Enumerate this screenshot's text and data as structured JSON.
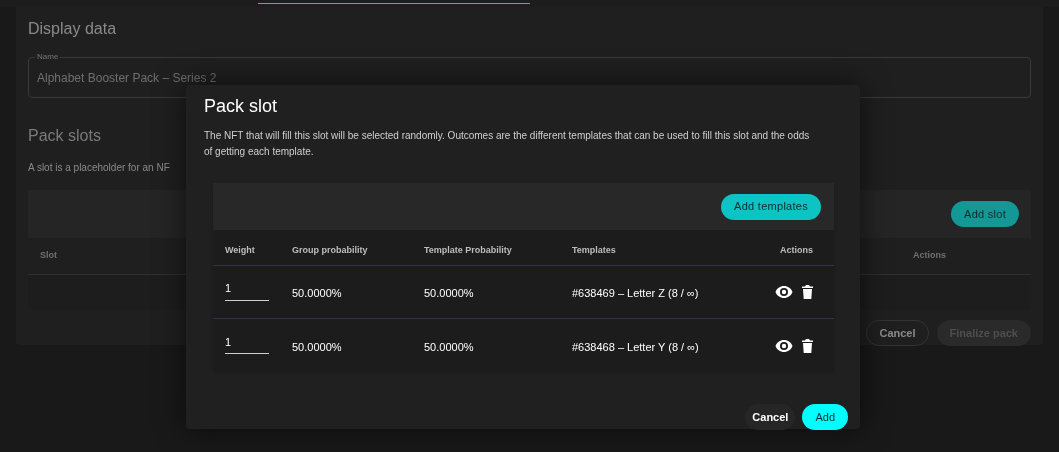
{
  "page": {
    "section_title": "Display data",
    "name_field": {
      "label": "Name",
      "value": "Alphabet Booster Pack – Series 2"
    },
    "slots_title": "Pack slots",
    "slots_description": "A slot is a placeholder for an NF",
    "add_slot_button": "Add slot",
    "columns": [
      "Slot",
      "Actions"
    ],
    "cancel_button": "Cancel",
    "finalize_button": {
      "label": "Finalize pack",
      "disabled": true
    }
  },
  "dialog": {
    "title": "Pack slot",
    "description": "The NFT that will fill this slot will be selected randomly. Outcomes are the different templates that can be used to fill this slot and the odds of getting each template.",
    "add_templates_button": "Add templates",
    "columns": [
      "Weight",
      "Group probability",
      "Template Probability",
      "Templates",
      "Actions"
    ],
    "rows": [
      {
        "weight": "1",
        "group_probability": "50.0000%",
        "template_probability": "50.0000%",
        "template": "#638469 – Letter Z (8 / ∞)"
      },
      {
        "weight": "1",
        "group_probability": "50.0000%",
        "template_probability": "50.0000%",
        "template": "#638468 – Letter Y (8 / ∞)"
      }
    ],
    "cancel_button": "Cancel",
    "add_button": "Add"
  }
}
